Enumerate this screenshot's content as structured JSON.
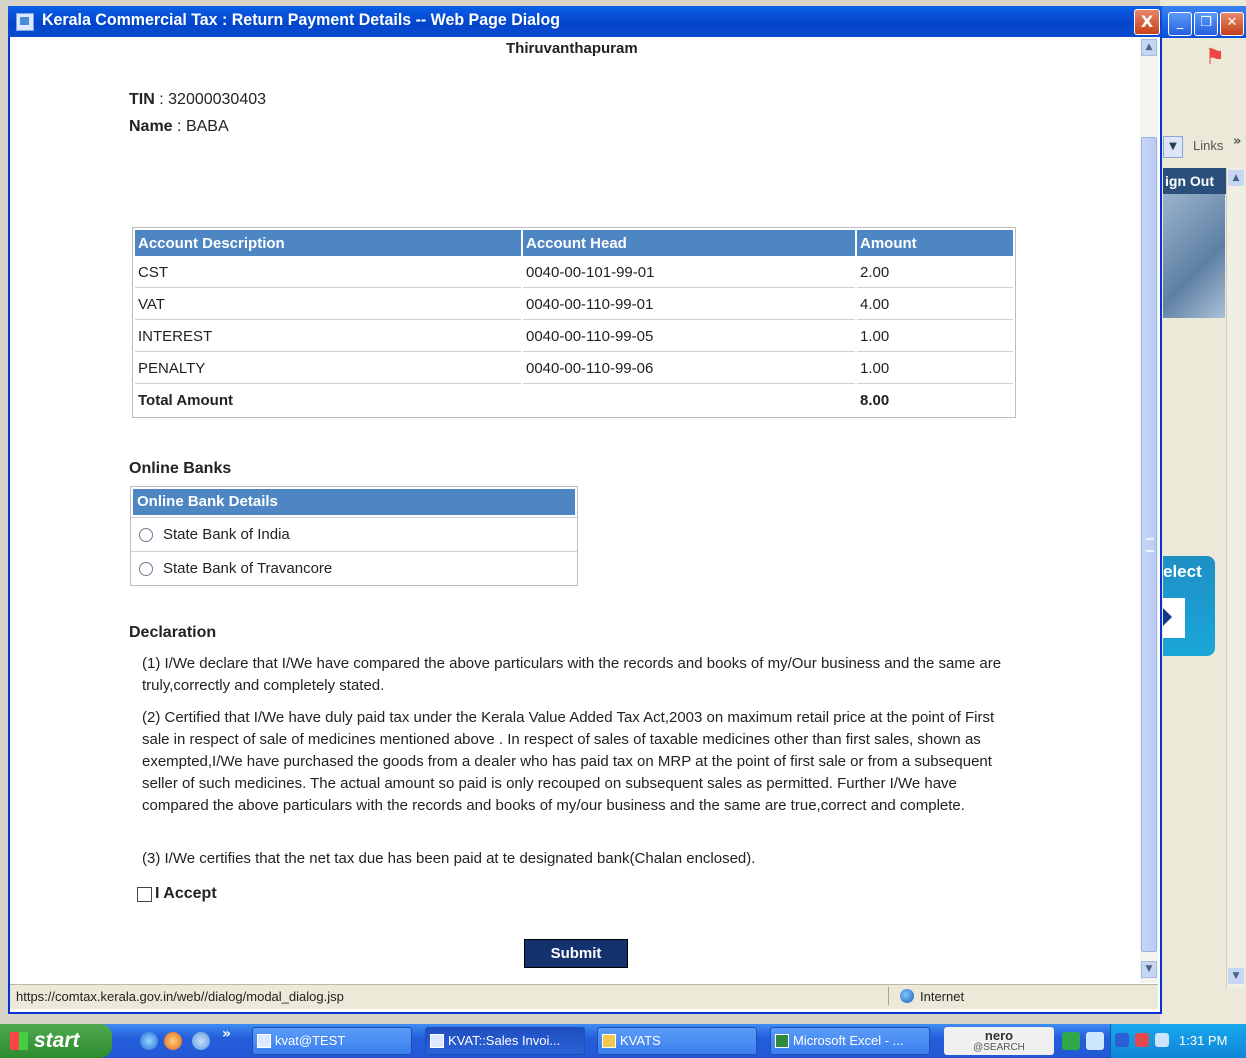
{
  "dialog": {
    "title": "Kerala Commercial Tax : Return Payment Details -- Web Page Dialog",
    "close_symbol": "X"
  },
  "page": {
    "city": "Thiruvanthapuram",
    "tin_label": "TIN",
    "tin_sep": ":",
    "tin_value": "32000030403",
    "name_label": "Name",
    "name_sep": ":",
    "name_value": "BABA"
  },
  "accounts_table": {
    "headers": [
      "Account Description",
      "Account Head",
      "Amount"
    ],
    "rows": [
      {
        "description": "CST",
        "head": "0040-00-101-99-01",
        "amount": "2.00"
      },
      {
        "description": "VAT",
        "head": "0040-00-110-99-01",
        "amount": "4.00"
      },
      {
        "description": "INTEREST",
        "head": "0040-00-110-99-05",
        "amount": "1.00"
      },
      {
        "description": "PENALTY",
        "head": "0040-00-110-99-06",
        "amount": "1.00"
      }
    ],
    "total_label": "Total Amount",
    "total_value": "8.00"
  },
  "online_banks": {
    "section_title": "Online Banks",
    "header": "Online Bank Details",
    "options": [
      "State Bank of India",
      "State Bank of Travancore"
    ],
    "selected_index": null
  },
  "declaration": {
    "title": "Declaration",
    "items": [
      "(1) I/We declare that I/We have compared the above particulars with the records and books of my/Our business and the same are truly,correctly and completely stated.",
      "(2) Certified that I/We have duly paid tax under the Kerala Value Added Tax Act,2003 on maximum retail price at the point of First sale in respect of sale of medicines mentioned above . In respect of sales of taxable medicines other than first sales, shown as exempted,I/We have purchased the goods from a dealer who has paid tax on MRP at the point of first sale or from a subsequent seller of such medicines. The actual amount so paid is only recouped on subsequent sales as permitted. Further I/We have compared the above particulars with the records and books of my/our business and the same are true,correct and complete.",
      "(3) I/We certifies that the net tax due has been paid at te designated bank(Chalan enclosed)."
    ],
    "accept_label": "I Accept",
    "accept_checked": false
  },
  "submit_label": "Submit",
  "statusbar": {
    "url": "https://comtax.kerala.gov.in/web//dialog/modal_dialog.jsp",
    "zone": "Internet"
  },
  "background_window": {
    "links_label": "Links",
    "more_symbol": "»",
    "signout_label": "ign Out",
    "select_label": "elect"
  },
  "taskbar": {
    "start_label": "start",
    "more_symbol": "»",
    "buttons": [
      {
        "label": "kvat@TEST",
        "active": false
      },
      {
        "label": "KVAT::Sales Invoi...",
        "active": true
      },
      {
        "label": "KVATS",
        "active": false
      },
      {
        "label": "Microsoft Excel - ...",
        "active": false
      }
    ],
    "nero_top": "nero",
    "nero_bottom": "@SEARCH",
    "clock": "1:31 PM"
  },
  "colors": {
    "table_header": "#4e86c4",
    "submit_bg": "#14326e",
    "titlebar": "#0345c9"
  }
}
